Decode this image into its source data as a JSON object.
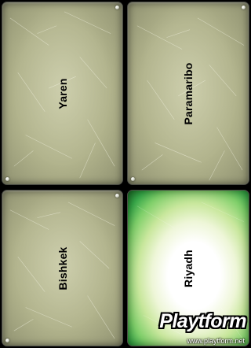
{
  "cards": [
    {
      "label": "Yaren",
      "state": "face-down"
    },
    {
      "label": "Paramaribo",
      "state": "face-down"
    },
    {
      "label": "Bishkek",
      "state": "face-down"
    },
    {
      "label": "Riyadh",
      "state": "selected"
    }
  ],
  "watermark": {
    "logo": "Playtform",
    "url": "www.playtform.net"
  },
  "colors": {
    "card_face": "#b1b38c",
    "card_border": "#4a4c44",
    "selected_glow": "#38a84a",
    "background": "#000000"
  }
}
